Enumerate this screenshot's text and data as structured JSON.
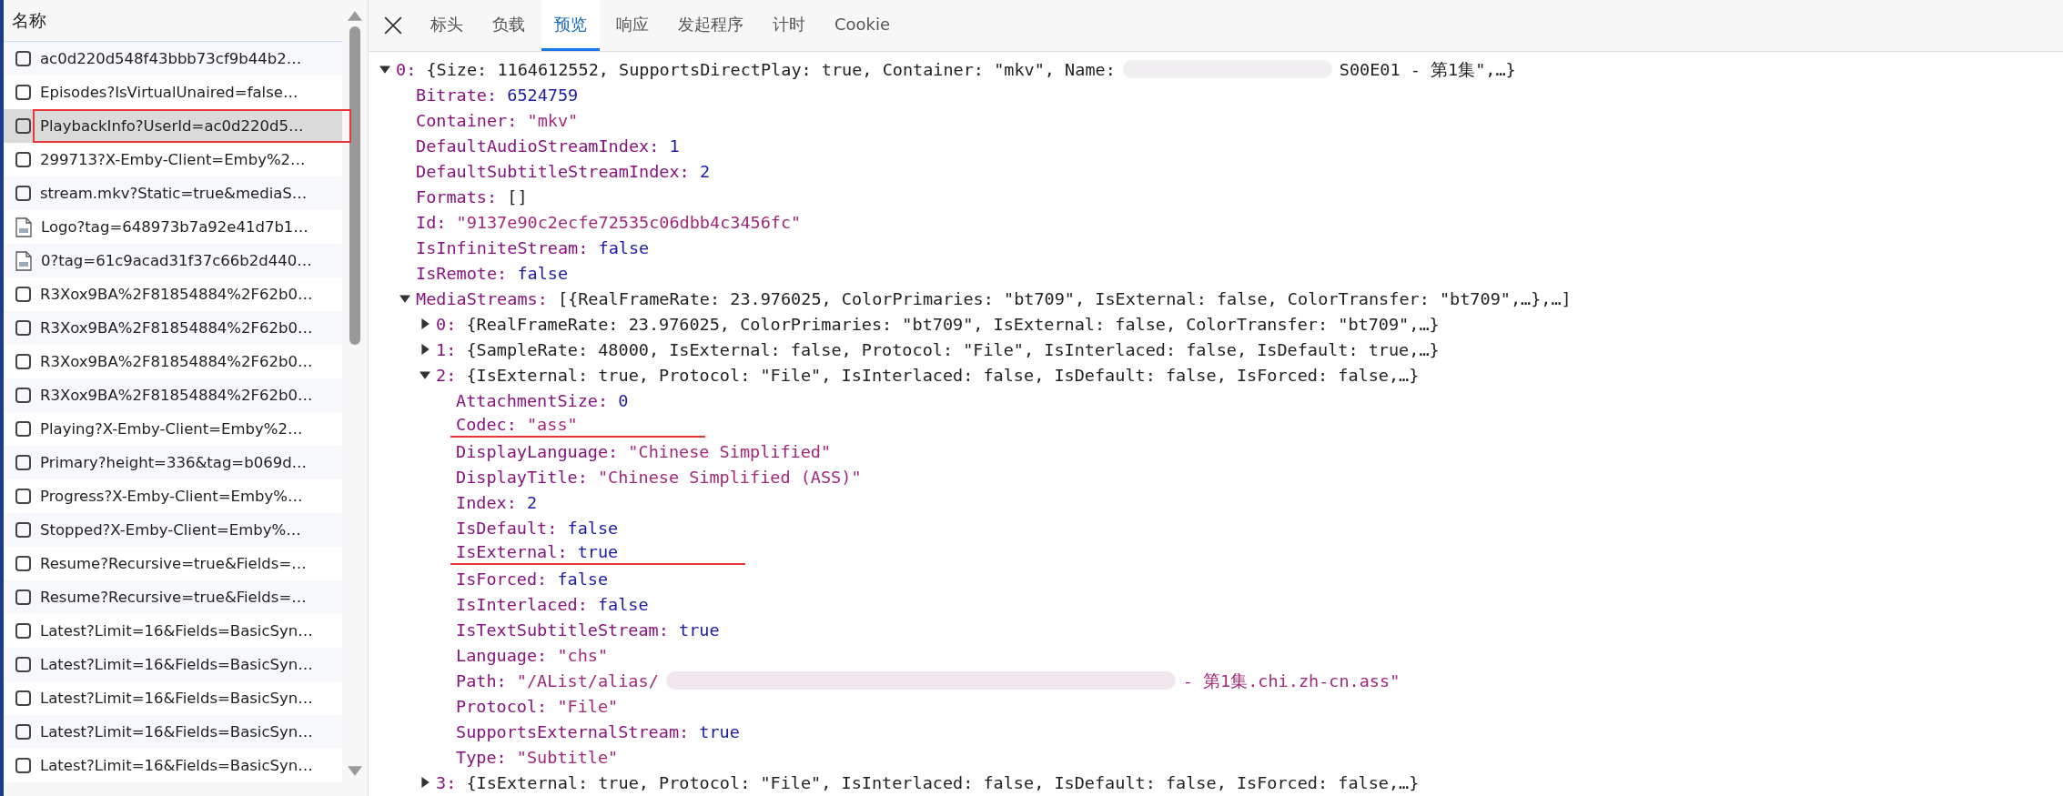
{
  "requests": {
    "header": "名称",
    "items": [
      {
        "name": "ac0d220d548f43bbb73cf9b44b2…",
        "kind": "document",
        "selected": false,
        "highlighted": false
      },
      {
        "name": "Episodes?IsVirtualUnaired=false…",
        "kind": "document",
        "selected": false,
        "highlighted": false
      },
      {
        "name": "PlaybackInfo?UserId=ac0d220d5…",
        "kind": "document",
        "selected": true,
        "highlighted": true
      },
      {
        "name": "299713?X-Emby-Client=Emby%2…",
        "kind": "document",
        "selected": false,
        "highlighted": false
      },
      {
        "name": "stream.mkv?Static=true&mediaS…",
        "kind": "document",
        "selected": false,
        "highlighted": false
      },
      {
        "name": "Logo?tag=648973b7a92e41d7b1…",
        "kind": "image",
        "selected": false,
        "highlighted": false
      },
      {
        "name": "0?tag=61c9acad31f37c66b2d440…",
        "kind": "image",
        "selected": false,
        "highlighted": false
      },
      {
        "name": "R3Xox9BA%2F81854884%2F62b0…",
        "kind": "document",
        "selected": false,
        "highlighted": false
      },
      {
        "name": "R3Xox9BA%2F81854884%2F62b0…",
        "kind": "document",
        "selected": false,
        "highlighted": false
      },
      {
        "name": "R3Xox9BA%2F81854884%2F62b0…",
        "kind": "document",
        "selected": false,
        "highlighted": false
      },
      {
        "name": "R3Xox9BA%2F81854884%2F62b0…",
        "kind": "document",
        "selected": false,
        "highlighted": false
      },
      {
        "name": "Playing?X-Emby-Client=Emby%2…",
        "kind": "document",
        "selected": false,
        "highlighted": false
      },
      {
        "name": "Primary?height=336&tag=b069d…",
        "kind": "document",
        "selected": false,
        "highlighted": false
      },
      {
        "name": "Progress?X-Emby-Client=Emby%…",
        "kind": "document",
        "selected": false,
        "highlighted": false
      },
      {
        "name": "Stopped?X-Emby-Client=Emby%…",
        "kind": "document",
        "selected": false,
        "highlighted": false
      },
      {
        "name": "Resume?Recursive=true&Fields=…",
        "kind": "document",
        "selected": false,
        "highlighted": false
      },
      {
        "name": "Resume?Recursive=true&Fields=…",
        "kind": "document",
        "selected": false,
        "highlighted": false
      },
      {
        "name": "Latest?Limit=16&Fields=BasicSyn…",
        "kind": "document",
        "selected": false,
        "highlighted": false
      },
      {
        "name": "Latest?Limit=16&Fields=BasicSyn…",
        "kind": "document",
        "selected": false,
        "highlighted": false
      },
      {
        "name": "Latest?Limit=16&Fields=BasicSyn…",
        "kind": "document",
        "selected": false,
        "highlighted": false
      },
      {
        "name": "Latest?Limit=16&Fields=BasicSyn…",
        "kind": "document",
        "selected": false,
        "highlighted": false
      },
      {
        "name": "Latest?Limit=16&Fields=BasicSyn…",
        "kind": "document",
        "selected": false,
        "highlighted": false
      }
    ]
  },
  "tabs": [
    {
      "label": "标头",
      "selected": false
    },
    {
      "label": "负载",
      "selected": false
    },
    {
      "label": "预览",
      "selected": true
    },
    {
      "label": "响应",
      "selected": false
    },
    {
      "label": "发起程序",
      "selected": false
    },
    {
      "label": "计时",
      "selected": false
    },
    {
      "label": "Cookie",
      "selected": false
    }
  ],
  "preview": [
    {
      "key": "0:",
      "expanded": true,
      "summary": "{Size: 1164612552, SupportsDirectPlay: true, Container: \"mkv\", Name:",
      "summary_after_redaction": "S00E01 - 第1集\",…}",
      "children": [
        {
          "key": "Bitrate:",
          "value": "6524759",
          "kind": "number"
        },
        {
          "key": "Container:",
          "value": "\"mkv\"",
          "kind": "string"
        },
        {
          "key": "DefaultAudioStreamIndex:",
          "value": "1",
          "kind": "number"
        },
        {
          "key": "DefaultSubtitleStreamIndex:",
          "value": "2",
          "kind": "number"
        },
        {
          "key": "Formats:",
          "value": "[]",
          "kind": "array"
        },
        {
          "key": "Id:",
          "value": "\"9137e90c2ecfe72535c06dbb4c3456fc\"",
          "kind": "string"
        },
        {
          "key": "IsInfiniteStream:",
          "value": "false",
          "kind": "boolean"
        },
        {
          "key": "IsRemote:",
          "value": "false",
          "kind": "boolean"
        },
        {
          "key": "MediaStreams:",
          "expanded": true,
          "summary": "[{RealFrameRate: 23.976025, ColorPrimaries: \"bt709\", IsExternal: false, ColorTransfer: \"bt709\",…},…]",
          "children": [
            {
              "key": "0:",
              "expanded": false,
              "summary": "{RealFrameRate: 23.976025, ColorPrimaries: \"bt709\", IsExternal: false, ColorTransfer: \"bt709\",…}"
            },
            {
              "key": "1:",
              "expanded": false,
              "summary": "{SampleRate: 48000, IsExternal: false, Protocol: \"File\", IsInterlaced: false, IsDefault: true,…}"
            },
            {
              "key": "2:",
              "expanded": true,
              "summary": "{IsExternal: true, Protocol: \"File\", IsInterlaced: false, IsDefault: false, IsForced: false,…}",
              "children": [
                {
                  "key": "AttachmentSize:",
                  "value": "0",
                  "kind": "number"
                },
                {
                  "key": "Codec:",
                  "value": "\"ass\"",
                  "kind": "string",
                  "underlined": true
                },
                {
                  "key": "DisplayLanguage:",
                  "value": "\"Chinese Simplified\"",
                  "kind": "string"
                },
                {
                  "key": "DisplayTitle:",
                  "value": "\"Chinese Simplified (ASS)\"",
                  "kind": "string"
                },
                {
                  "key": "Index:",
                  "value": "2",
                  "kind": "number"
                },
                {
                  "key": "IsDefault:",
                  "value": "false",
                  "kind": "boolean"
                },
                {
                  "key": "IsExternal:",
                  "value": "true",
                  "kind": "boolean",
                  "underlined": true
                },
                {
                  "key": "IsForced:",
                  "value": "false",
                  "kind": "boolean"
                },
                {
                  "key": "IsInterlaced:",
                  "value": "false",
                  "kind": "boolean"
                },
                {
                  "key": "IsTextSubtitleStream:",
                  "value": "true",
                  "kind": "boolean"
                },
                {
                  "key": "Language:",
                  "value": "\"chs\"",
                  "kind": "string"
                },
                {
                  "key": "Path:",
                  "value": "\"/AList/alias/",
                  "value_after_redaction": "- 第1集.chi.zh-cn.ass\"",
                  "kind": "string"
                },
                {
                  "key": "Protocol:",
                  "value": "\"File\"",
                  "kind": "string"
                },
                {
                  "key": "SupportsExternalStream:",
                  "value": "true",
                  "kind": "boolean"
                },
                {
                  "key": "Type:",
                  "value": "\"Subtitle\"",
                  "kind": "string"
                }
              ]
            },
            {
              "key": "3:",
              "expanded": false,
              "summary": "{IsExternal: true, Protocol: \"File\", IsInterlaced: false, IsDefault: false, IsForced: false,…}"
            }
          ]
        }
      ]
    }
  ]
}
